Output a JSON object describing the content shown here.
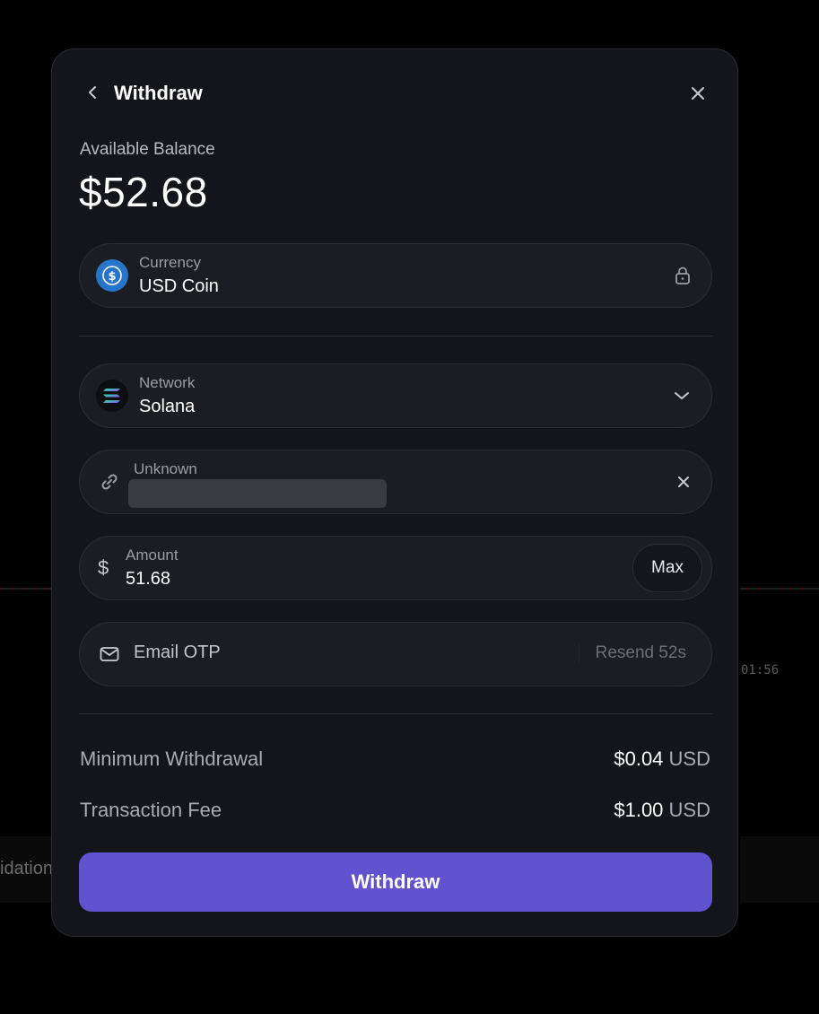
{
  "background": {
    "time_fragment": "01:56",
    "text_fragment": "idation"
  },
  "modal": {
    "title": "Withdraw",
    "balance_label": "Available Balance",
    "balance_value": "$52.68",
    "currency": {
      "label": "Currency",
      "value": "USD Coin"
    },
    "network": {
      "label": "Network",
      "value": "Solana"
    },
    "address": {
      "label": "Unknown",
      "value": ""
    },
    "amount": {
      "label": "Amount",
      "value": "51.68",
      "max_label": "Max"
    },
    "otp": {
      "placeholder": "Email OTP",
      "resend_label": "Resend 52s"
    },
    "minimum_withdrawal": {
      "label": "Minimum Withdrawal",
      "amount": "$0.04",
      "unit": "USD"
    },
    "transaction_fee": {
      "label": "Transaction Fee",
      "amount": "$1.00",
      "unit": "USD"
    },
    "submit_label": "Withdraw"
  },
  "colors": {
    "accent": "#6153cf",
    "usdc": "#2775ca",
    "panel": "#14151a",
    "field": "#1c1d23"
  }
}
